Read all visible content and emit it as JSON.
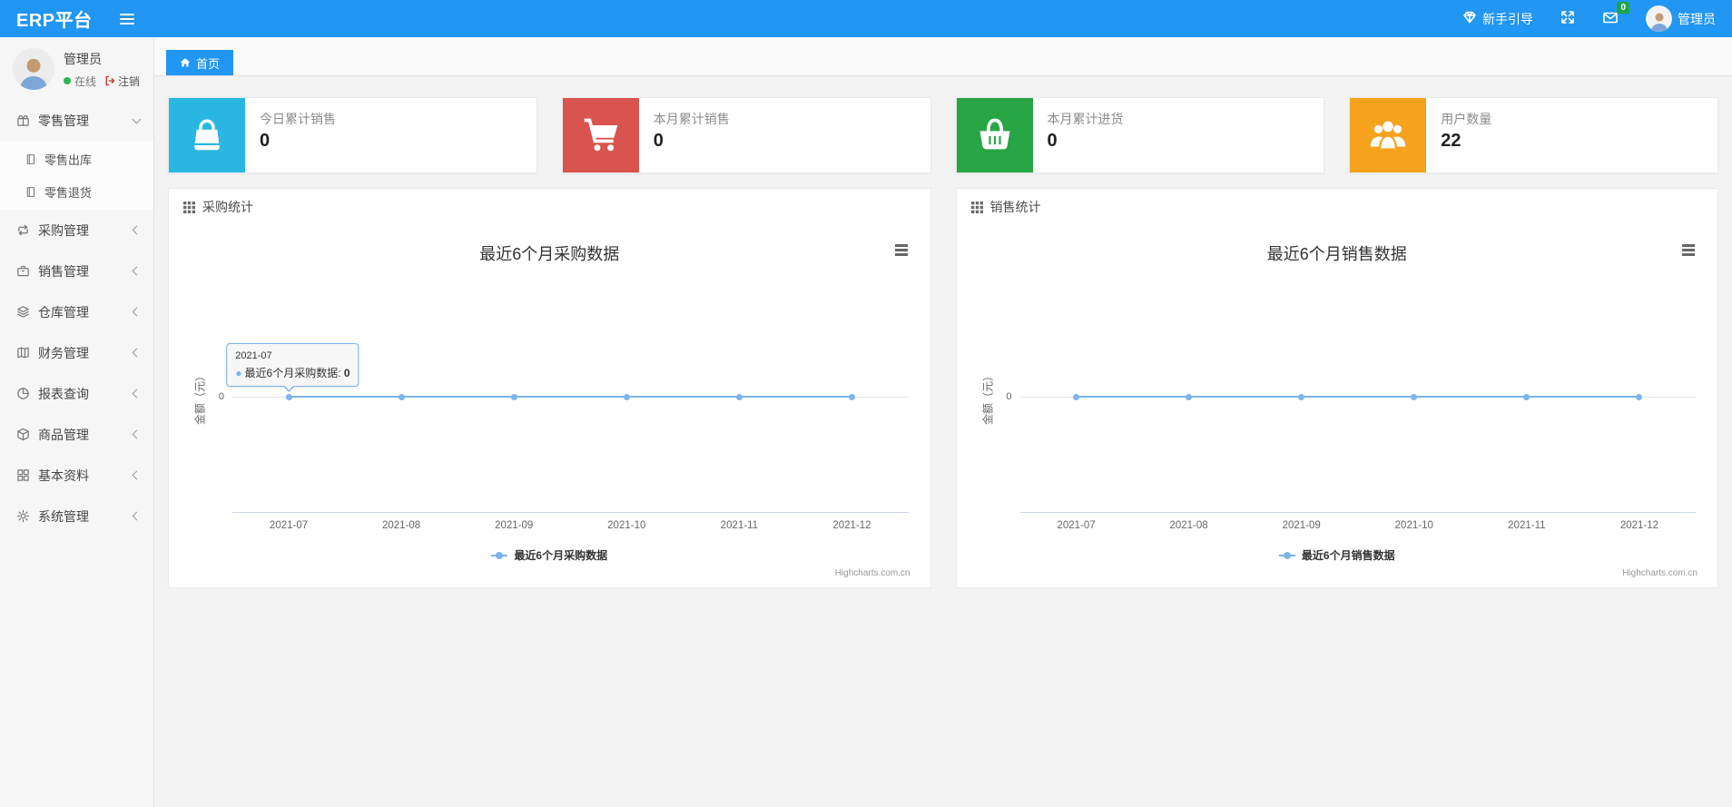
{
  "navbar": {
    "brand": "ERP平台",
    "guide_label": "新手引导",
    "mail_badge": "0",
    "user_name": "管理员",
    "accent_color": "#2196f3",
    "badge_color": "#1fa44e"
  },
  "sidebar": {
    "user": {
      "name": "管理员",
      "status_online": "在线",
      "logout_label": "注销"
    },
    "items": [
      {
        "label": "零售管理",
        "icon": "gift-icon",
        "expanded": true,
        "children": [
          {
            "label": "零售出库",
            "icon": "journal-icon"
          },
          {
            "label": "零售退货",
            "icon": "journal-icon"
          }
        ]
      },
      {
        "label": "采购管理",
        "icon": "repeat-icon"
      },
      {
        "label": "销售管理",
        "icon": "briefcase-icon"
      },
      {
        "label": "仓库管理",
        "icon": "layers-icon"
      },
      {
        "label": "财务管理",
        "icon": "ledger-icon"
      },
      {
        "label": "报表查询",
        "icon": "pie-chart-icon"
      },
      {
        "label": "商品管理",
        "icon": "box-icon"
      },
      {
        "label": "基本资料",
        "icon": "grid-icon"
      },
      {
        "label": "系统管理",
        "icon": "gear-icon"
      }
    ]
  },
  "tabs": {
    "home": "首页"
  },
  "cards": [
    {
      "label": "今日累计销售",
      "value": "0",
      "color": "#29b7e2",
      "icon": "shopping-bag-icon"
    },
    {
      "label": "本月累计销售",
      "value": "0",
      "color": "#d9534f",
      "icon": "shopping-cart-icon"
    },
    {
      "label": "本月累计进货",
      "value": "0",
      "color": "#28a545",
      "icon": "shopping-basket-icon"
    },
    {
      "label": "用户数量",
      "value": "22",
      "color": "#f5a31c",
      "icon": "users-icon"
    }
  ],
  "panels": [
    {
      "header": "采购统计"
    },
    {
      "header": "销售统计"
    }
  ],
  "chart_data": [
    {
      "type": "line",
      "title": "最近6个月采购数据",
      "x": [
        "2021-07",
        "2021-08",
        "2021-09",
        "2021-10",
        "2021-11",
        "2021-12"
      ],
      "series": [
        {
          "name": "最近6个月采购数据",
          "values": [
            0,
            0,
            0,
            0,
            0,
            0
          ],
          "color": "#7cb5ec"
        }
      ],
      "ylabel": "金额（元）",
      "y_ticks": [
        "0"
      ],
      "ylim": [
        -1,
        1
      ],
      "grid": false,
      "legend_position": "bottom",
      "credits": "Highcharts.com.cn",
      "tooltip": {
        "x": "2021-07",
        "series": "最近6个月采购数据",
        "value": "0"
      }
    },
    {
      "type": "line",
      "title": "最近6个月销售数据",
      "x": [
        "2021-07",
        "2021-08",
        "2021-09",
        "2021-10",
        "2021-11",
        "2021-12"
      ],
      "series": [
        {
          "name": "最近6个月销售数据",
          "values": [
            0,
            0,
            0,
            0,
            0,
            0
          ],
          "color": "#7cb5ec"
        }
      ],
      "ylabel": "金额（元）",
      "y_ticks": [
        "0"
      ],
      "ylim": [
        -1,
        1
      ],
      "grid": false,
      "legend_position": "bottom",
      "credits": "Highcharts.com.cn"
    }
  ]
}
